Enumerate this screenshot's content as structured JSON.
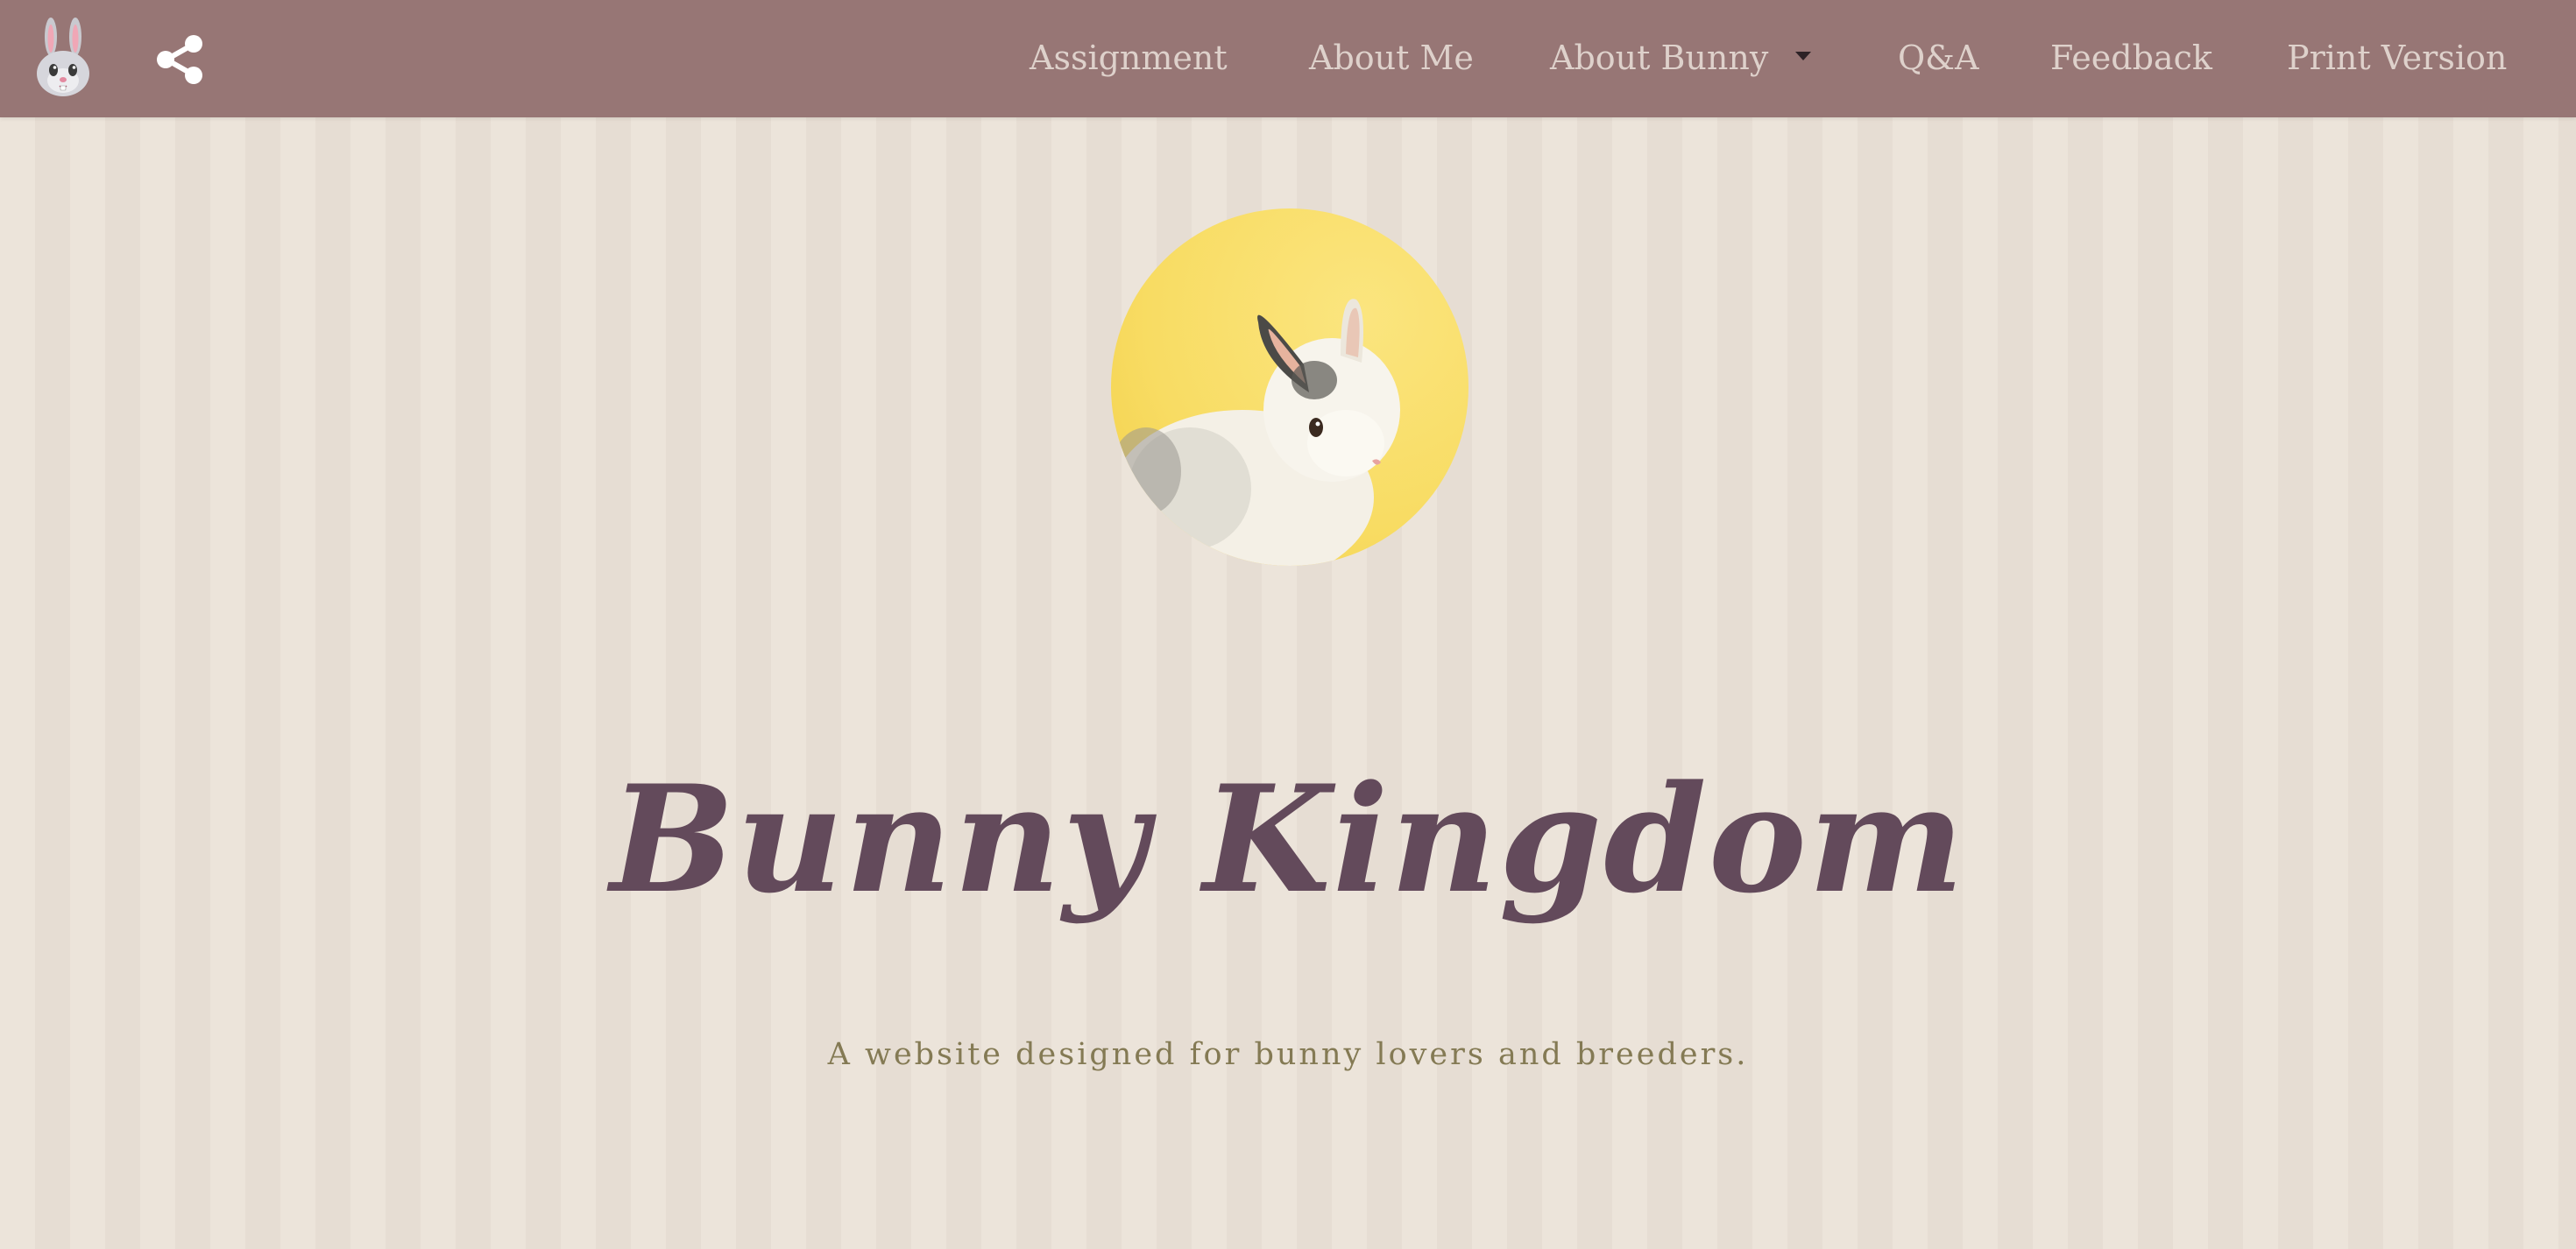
{
  "nav": {
    "brand_icon": "bunny-face-icon",
    "share_icon": "share-icon",
    "items": [
      {
        "label": "Assignment"
      },
      {
        "label": "About Me"
      },
      {
        "label": "About Bunny",
        "has_dropdown": true
      },
      {
        "label": "Q&A"
      },
      {
        "label": "Feedback"
      },
      {
        "label": "Print Version"
      }
    ]
  },
  "hero": {
    "image_subject": "white rabbit on yellow background",
    "title": "Bunny Kingdom",
    "tagline": "A website designed for bunny lovers and breeders."
  },
  "colors": {
    "navbar": "#977675",
    "nav_text": "#ded1cb",
    "title": "#634a5b",
    "tagline": "#847a54",
    "background": "#ece4da"
  }
}
